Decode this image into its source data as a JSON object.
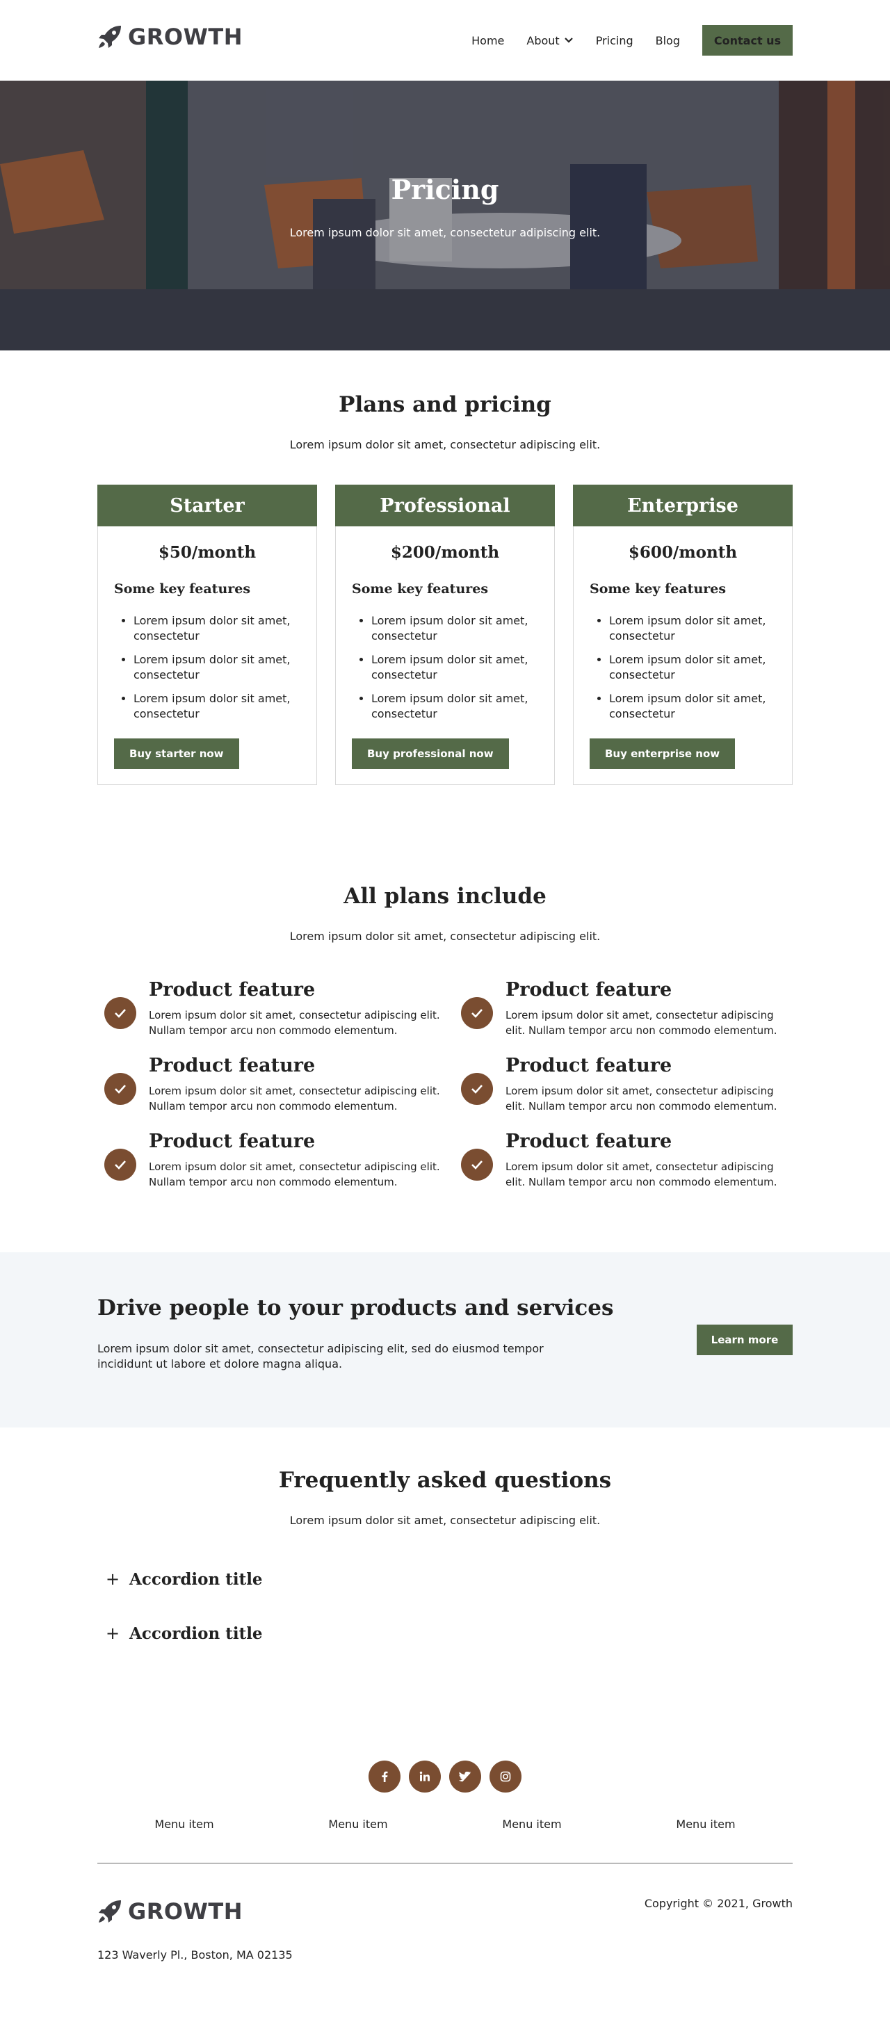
{
  "brand": {
    "name": "GROWTH",
    "logo_icon": "rocket-icon"
  },
  "nav": {
    "items": [
      {
        "label": "Home"
      },
      {
        "label": "About",
        "icon": "chevron-down-icon"
      },
      {
        "label": "Pricing"
      },
      {
        "label": "Blog"
      }
    ],
    "cta": "Contact us"
  },
  "hero": {
    "title": "Pricing",
    "subtitle": "Lorem ipsum dolor sit amet, consectetur adipiscing elit."
  },
  "pricing": {
    "title": "Plans and pricing",
    "subtitle": "Lorem ipsum dolor sit amet, consectetur adipiscing elit.",
    "plans": [
      {
        "name": "Starter",
        "price": "$50/month",
        "features_title": "Some key features",
        "features": [
          "Lorem ipsum dolor sit amet, consectetur",
          "Lorem ipsum dolor sit amet, consectetur",
          "Lorem ipsum dolor sit amet, consectetur"
        ],
        "button": "Buy starter now"
      },
      {
        "name": "Professional",
        "price": "$200/month",
        "features_title": "Some key features",
        "features": [
          "Lorem ipsum dolor sit amet, consectetur",
          "Lorem ipsum dolor sit amet, consectetur",
          "Lorem ipsum dolor sit amet, consectetur"
        ],
        "button": "Buy professional now"
      },
      {
        "name": "Enterprise",
        "price": "$600/month",
        "features_title": "Some key features",
        "features": [
          "Lorem ipsum dolor sit amet, consectetur",
          "Lorem ipsum dolor sit amet, consectetur",
          "Lorem ipsum dolor sit amet, consectetur"
        ],
        "button": "Buy enterprise now"
      }
    ]
  },
  "features": {
    "title": "All plans include",
    "subtitle": "Lorem ipsum dolor sit amet, consectetur adipiscing elit.",
    "items": [
      {
        "title": "Product feature",
        "text": "Lorem ipsum dolor sit amet, consectetur adipiscing elit. Nullam tempor arcu non commodo elementum."
      },
      {
        "title": "Product feature",
        "text": "Lorem ipsum dolor sit amet, consectetur adipiscing elit. Nullam tempor arcu non commodo elementum."
      },
      {
        "title": "Product feature",
        "text": "Lorem ipsum dolor sit amet, consectetur adipiscing elit. Nullam tempor arcu non commodo elementum."
      },
      {
        "title": "Product feature",
        "text": "Lorem ipsum dolor sit amet, consectetur adipiscing elit. Nullam tempor arcu non commodo elementum."
      },
      {
        "title": "Product feature",
        "text": "Lorem ipsum dolor sit amet, consectetur adipiscing elit. Nullam tempor arcu non commodo elementum."
      },
      {
        "title": "Product feature",
        "text": "Lorem ipsum dolor sit amet, consectetur adipiscing elit. Nullam tempor arcu non commodo elementum."
      }
    ]
  },
  "cta": {
    "title": "Drive people to your products and services",
    "text": "Lorem ipsum dolor sit amet, consectetur adipiscing elit, sed do eiusmod tempor incididunt ut labore et dolore magna aliqua.",
    "button": "Learn more"
  },
  "faq": {
    "title": "Frequently asked questions",
    "subtitle": "Lorem ipsum dolor sit amet, consectetur adipiscing elit.",
    "items": [
      {
        "title": "Accordion title"
      },
      {
        "title": "Accordion title"
      }
    ]
  },
  "footer": {
    "social": [
      "facebook-icon",
      "linkedin-icon",
      "twitter-icon",
      "instagram-icon"
    ],
    "menu": [
      "Menu item",
      "Menu item",
      "Menu item",
      "Menu item"
    ],
    "copyright": "Copyright © 2021, Growth",
    "address": "123 Waverly Pl., Boston, MA 02135"
  },
  "colors": {
    "primary": "#546a48",
    "accent": "#7a4d31",
    "cta_background": "#f3f6f9",
    "text": "#222222"
  }
}
